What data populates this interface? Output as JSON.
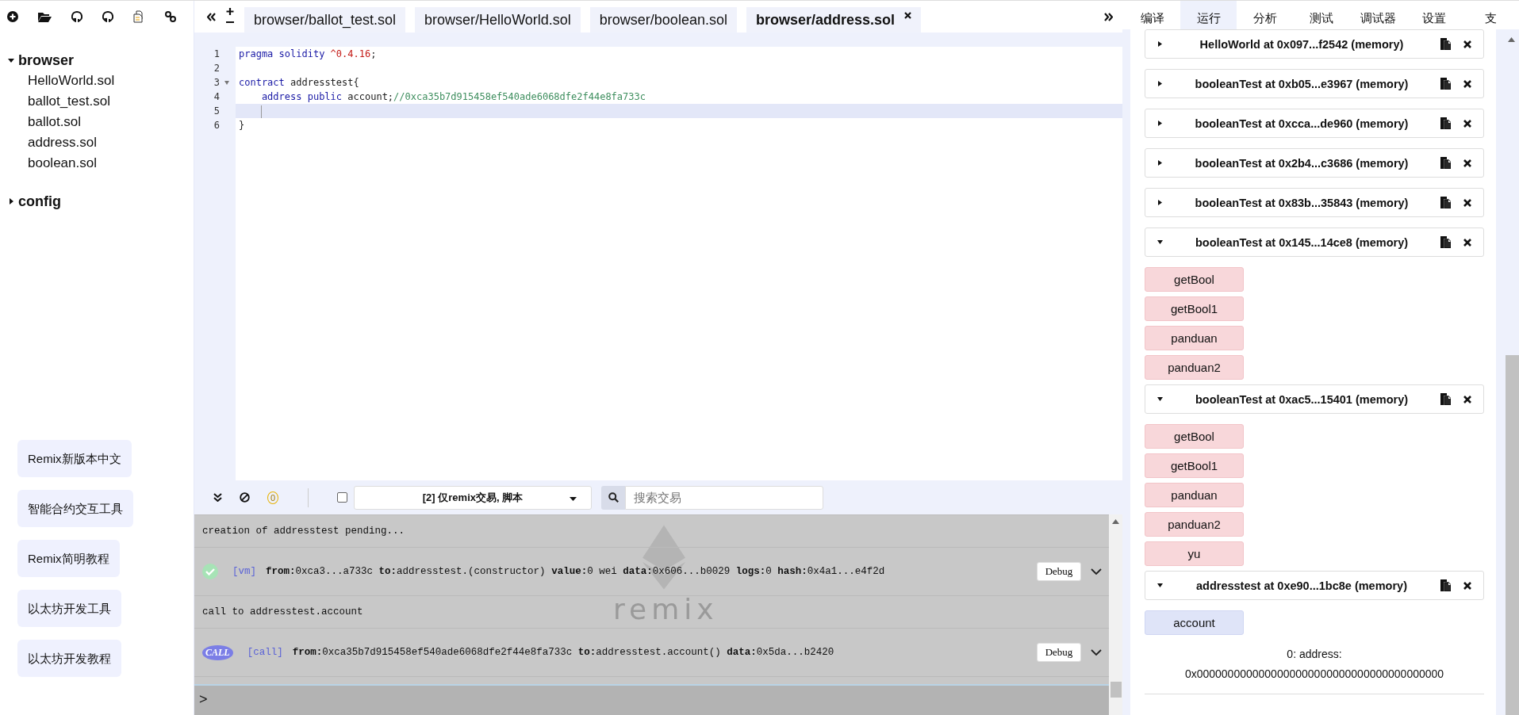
{
  "file_tree": [
    {
      "label": "browser",
      "expanded": true,
      "children": [
        {
          "label": "HelloWorld.sol"
        },
        {
          "label": "ballot_test.sol"
        },
        {
          "label": "ballot.sol"
        },
        {
          "label": "address.sol"
        },
        {
          "label": "boolean.sol"
        }
      ]
    },
    {
      "label": "config",
      "expanded": false
    }
  ],
  "links": [
    "Remix新版本中文",
    "智能合约交互工具",
    "Remix简明教程",
    "以太坊开发工具",
    "以太坊开发教程"
  ],
  "editor": {
    "tabs": [
      {
        "label": "browser/ballot_test.sol",
        "selected": false
      },
      {
        "label": "browser/HelloWorld.sol",
        "selected": false
      },
      {
        "label": "browser/boolean.sol",
        "selected": false
      },
      {
        "label": "browser/address.sol",
        "selected": true
      }
    ],
    "lines": [
      {
        "number": "1",
        "foldable": false,
        "active": false,
        "tokens": [
          {
            "t": "pragma solidity ",
            "kind": "keyword"
          },
          {
            "t": "^0.4.16",
            "kind": "number"
          },
          {
            "t": ";",
            "kind": "plain"
          }
        ]
      },
      {
        "number": "2",
        "foldable": false,
        "active": false
      },
      {
        "number": "3",
        "foldable": true,
        "active": false,
        "tokens": [
          {
            "t": "contract ",
            "kind": "keyword"
          },
          {
            "t": "addresstest{",
            "kind": "plain"
          }
        ]
      },
      {
        "number": "4",
        "foldable": false,
        "active": false,
        "tokens": [
          {
            "t": "    address public ",
            "kind": "keyword"
          },
          {
            "t": "account;",
            "kind": "plain"
          },
          {
            "t": "//0xca35b7d915458ef540ade6068dfe2f44e8fa733c",
            "kind": "comment"
          }
        ]
      },
      {
        "number": "5",
        "foldable": false,
        "active": true
      },
      {
        "number": "6",
        "foldable": false,
        "active": false,
        "tokens": [
          {
            "t": "}",
            "kind": "plain"
          }
        ]
      }
    ]
  },
  "terminal": {
    "pending_count": "0",
    "filter_checked": false,
    "filter": "[2] 仅remix交易, 脚本",
    "search_placeholder": "搜索交易",
    "logo_text": "remix",
    "entries": [
      {
        "kind": "text",
        "text": "creation of addresstest pending..."
      },
      {
        "kind": "vm_tx",
        "tag": "[vm]",
        "detail": "**from:**0xca3...a733c **to:**addresstest.(constructor) **value:**0 wei **data:**0x606...b0029 **logs:**0 **hash:**0x4a1...e4f2d",
        "button": "Debug"
      },
      {
        "kind": "text",
        "text": "call to addresstest.account"
      },
      {
        "kind": "call_tx",
        "badge": "CALL",
        "tag": "[call]",
        "detail": "**from:**0xca35b7d915458ef540ade6068dfe2f44e8fa733c **to:**addresstest.account() **data:**0x5da...b2420",
        "button": "Debug"
      }
    ],
    "prompt": ">"
  },
  "side_tabs": [
    {
      "label": "编译",
      "selected": false
    },
    {
      "label": "运行",
      "selected": true
    },
    {
      "label": "分析",
      "selected": false
    },
    {
      "label": "测试",
      "selected": false
    },
    {
      "label": "调试器",
      "selected": false
    },
    {
      "label": "设置",
      "selected": false
    },
    {
      "label": "支",
      "selected": false
    }
  ],
  "instances": [
    {
      "title": "HelloWorld at 0x097...f2542 (memory)",
      "expanded": false
    },
    {
      "title": "booleanTest at 0xb05...e3967 (memory)",
      "expanded": false
    },
    {
      "title": "booleanTest at 0xcca...de960 (memory)",
      "expanded": false
    },
    {
      "title": "booleanTest at 0x2b4...c3686 (memory)",
      "expanded": false
    },
    {
      "title": "booleanTest at 0x83b...35843 (memory)",
      "expanded": false
    },
    {
      "title": "booleanTest at 0x145...14ce8 (memory)",
      "expanded": true,
      "functions": [
        {
          "label": "getBool",
          "kind": "transact"
        },
        {
          "label": "getBool1",
          "kind": "transact"
        },
        {
          "label": "panduan",
          "kind": "transact"
        },
        {
          "label": "panduan2",
          "kind": "transact"
        }
      ]
    },
    {
      "title": "booleanTest at 0xac5...15401 (memory)",
      "expanded": true,
      "functions": [
        {
          "label": "getBool",
          "kind": "transact"
        },
        {
          "label": "getBool1",
          "kind": "transact"
        },
        {
          "label": "panduan",
          "kind": "transact"
        },
        {
          "label": "panduan2",
          "kind": "transact"
        },
        {
          "label": "yu",
          "kind": "transact"
        }
      ]
    },
    {
      "title": "addresstest at 0xe90...1bc8e (memory)",
      "expanded": true,
      "functions": [
        {
          "label": "account",
          "kind": "call"
        }
      ],
      "outputs": [
        "0: address:",
        "0x0000000000000000000000000000000000000000"
      ]
    }
  ]
}
